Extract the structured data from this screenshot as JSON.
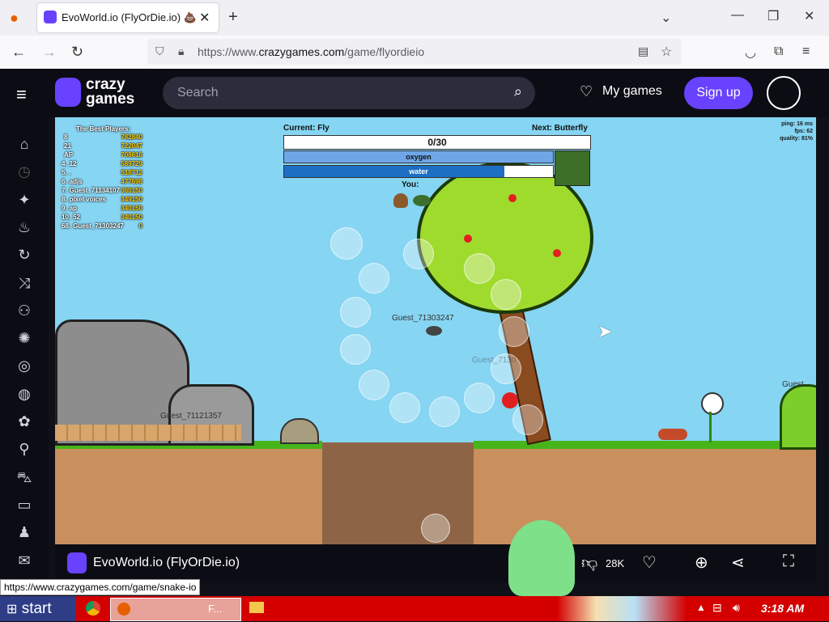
{
  "browser": {
    "tab_title": "EvoWorld.io (FlyOrDie.io) 💩",
    "new_tab": "+",
    "url_prefix": "https://www.",
    "url_domain": "crazygames.com",
    "url_path": "/game/flyordieio"
  },
  "site": {
    "logo_top": "crazy",
    "logo_bottom": "games",
    "search_placeholder": "Search",
    "my_games": "My games",
    "sign_up": "Sign up"
  },
  "rail_icons": [
    "home-icon",
    "clock-icon",
    "sparkle-icon",
    "flame-icon",
    "refresh-icon",
    "shuffle-icon",
    "multiplayer-icon",
    "burst-icon",
    "compass-icon",
    "basketball-icon",
    "flower-icon",
    "bike-icon",
    "car-icon",
    "card-icon",
    "chess-icon",
    "mail-icon"
  ],
  "game": {
    "leaderboard_title": "The Best Players:",
    "leaderboard": [
      {
        "rank": "",
        "name": "8",
        "score": "782840"
      },
      {
        "rank": "",
        "name": "21",
        "score": "722047"
      },
      {
        "rank": "",
        "name": "AP",
        "score": "708616"
      },
      {
        "rank": "4.",
        "name": "12",
        "score": "589729"
      },
      {
        "rank": "5.",
        "name": ".",
        "score": "518712"
      },
      {
        "rank": "6.",
        "name": "adjs",
        "score": "477698"
      },
      {
        "rank": "7.",
        "name": "Guest_71134107",
        "score": "360150"
      },
      {
        "rank": "8.",
        "name": "pixel voices",
        "score": "349150"
      },
      {
        "rank": "9.",
        "name": "ap",
        "score": "340150"
      },
      {
        "rank": "10.",
        "name": "52",
        "score": "340150"
      },
      {
        "rank": "68.",
        "name": "Guest_71303247",
        "score": "0"
      }
    ],
    "current_label": "Current: Fly",
    "next_label": "Next: Butterfly",
    "xp_text": "0/30",
    "xp_fraction": 0,
    "oxygen_label": "oxygen",
    "oxygen_fraction": 1.0,
    "water_label": "water",
    "water_fraction": 0.82,
    "you_label": "You:",
    "stats_ping": "ping: 16 ms",
    "stats_fps": "fps: 62",
    "stats_quality": "quality: 81%",
    "player_self": "Guest_71303247",
    "player_ghost": "Guest_7130",
    "player_left": "Guest_71121357",
    "player_right": "Guest",
    "chat_icon": "chat-bubble-icon"
  },
  "gamebar": {
    "title": "EvoWorld.io (FlyOrDie.io)",
    "likes": "28K"
  },
  "status_url": "https://www.crazygames.com/game/snake-io",
  "taskbar": {
    "start": "start",
    "window_label": "F...",
    "clock": "3:18 AM"
  },
  "colors": {
    "sky": "#86d5f2",
    "accent": "#6842ff",
    "taskbar": "#d40000"
  }
}
